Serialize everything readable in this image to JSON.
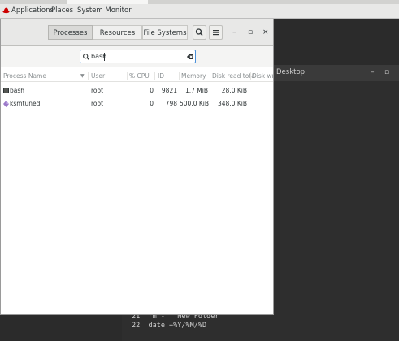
{
  "panel": {
    "applications": "Applications",
    "places": "Places",
    "app_menu": "System Monitor"
  },
  "terminal": {
    "title": "Desktop",
    "lines": [
      "21  rm -f  New Folder",
      "22  date +%Y/%M/%D"
    ]
  },
  "sysmon": {
    "tabs": [
      "Processes",
      "Resources",
      "File Systems"
    ],
    "active_tab": "Processes",
    "search": {
      "value": "bash"
    },
    "columns": [
      "Process Name",
      "User",
      "% CPU",
      "ID",
      "Memory",
      "Disk read tota",
      "Disk writ"
    ],
    "rows": [
      {
        "name": "bash",
        "user": "root",
        "cpu": "0",
        "id": "9821",
        "memory": "1.7 MiB",
        "disk_read": "28.0 KiB",
        "icon": "terminal-icon"
      },
      {
        "name": "ksmtuned",
        "user": "root",
        "cpu": "0",
        "id": "798",
        "memory": "500.0 KiB",
        "disk_read": "348.0 KiB",
        "icon": "diamond-icon"
      }
    ]
  },
  "colors": {
    "accent": "#4a90d9",
    "brand_red": "#cc0000"
  }
}
